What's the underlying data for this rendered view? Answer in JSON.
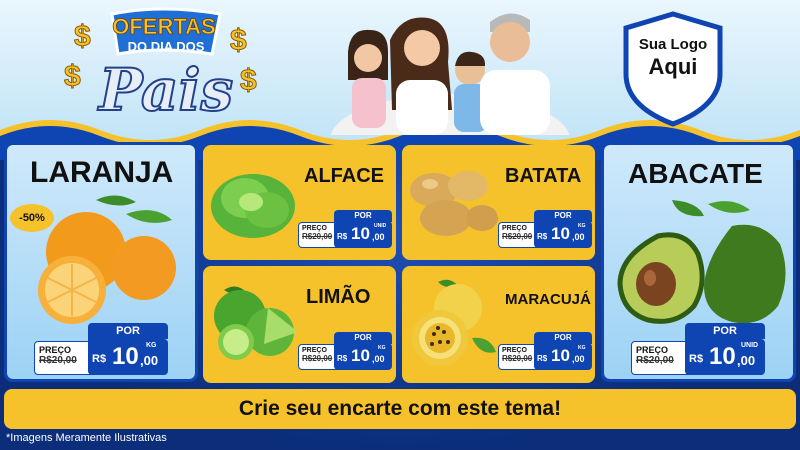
{
  "header": {
    "headline_line1": "OFERTAS",
    "headline_line2": "DO DIA DOS",
    "headline_line3": "Pais",
    "logo_line1": "Sua Logo",
    "logo_line2": "Aqui"
  },
  "products": {
    "laranja": {
      "name": "LARANJA",
      "discount": "-50%",
      "por": "POR",
      "preco_label": "PREÇO",
      "old_price": "R$20,00",
      "currency": "R$",
      "price_int": "10",
      "price_dec": ",00",
      "unit": "KG"
    },
    "alface": {
      "name": "ALFACE",
      "por": "POR",
      "preco_label": "PREÇO",
      "old_price": "R$20,00",
      "currency": "R$",
      "price_int": "10",
      "price_dec": ",00",
      "unit": "UNID"
    },
    "batata": {
      "name": "BATATA",
      "por": "POR",
      "preco_label": "PREÇO",
      "old_price": "R$20,00",
      "currency": "R$",
      "price_int": "10",
      "price_dec": ",00",
      "unit": "KG"
    },
    "abacate": {
      "name": "ABACATE",
      "por": "POR",
      "preco_label": "PREÇO",
      "old_price": "R$20,00",
      "currency": "R$",
      "price_int": "10",
      "price_dec": ",00",
      "unit": "UNID"
    },
    "limao": {
      "name": "LIMÃO",
      "por": "POR",
      "preco_label": "PREÇO",
      "old_price": "R$20,00",
      "currency": "R$",
      "price_int": "10",
      "price_dec": ",00",
      "unit": "KG"
    },
    "maracuja": {
      "name": "MARACUJÁ",
      "por": "POR",
      "preco_label": "PREÇO",
      "old_price": "R$20,00",
      "currency": "R$",
      "price_int": "10",
      "price_dec": ",00",
      "unit": "KG"
    }
  },
  "banner": {
    "text": "Crie seu encarte com este tema!"
  },
  "footnote": {
    "text": "*Imagens Meramente Ilustrativas"
  },
  "colors": {
    "card_yellow": "#f6c22c",
    "brand_blue": "#0f44b3",
    "navy": "#0b2d7a",
    "sky": "#bfe3f7"
  },
  "icons": [
    "headline-logo",
    "family-photo",
    "logo-shield-icon",
    "orange-image",
    "lettuce-image",
    "potato-image",
    "avocado-image",
    "lime-image",
    "passionfruit-image"
  ]
}
